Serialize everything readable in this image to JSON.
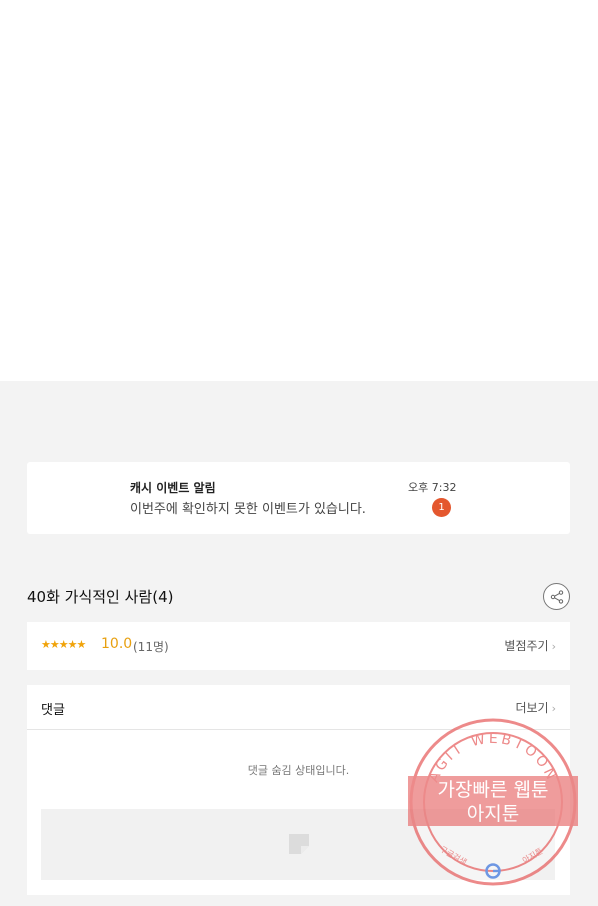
{
  "notification": {
    "title": "캐시 이벤트 알림",
    "message": "이번주에 확인하지 못한 이벤트가 있습니다.",
    "time": "오후 7:32",
    "badge_count": "1",
    "badge_color": "#e4572e"
  },
  "episode": {
    "title": "40화 가식적인 사람(4)",
    "share_icon": "share-icon"
  },
  "rating": {
    "stars": "★★★★★",
    "score": "10.0",
    "count": "(11명)",
    "rate_label": "별점주기",
    "chevron": "›",
    "accent_color": "#f0a30a"
  },
  "comments": {
    "label": "댓글",
    "more_label": "더보기",
    "chevron": "›",
    "hidden_message": "댓글 숨김 상태입니다."
  },
  "watermark": {
    "arc_text": "AGIT WEBTOON",
    "line1": "가장빠른 웹툰",
    "line2": "아지툰",
    "bottom_left": "구글검색",
    "bottom_right": "아지툰",
    "color": "#e86a6a"
  }
}
